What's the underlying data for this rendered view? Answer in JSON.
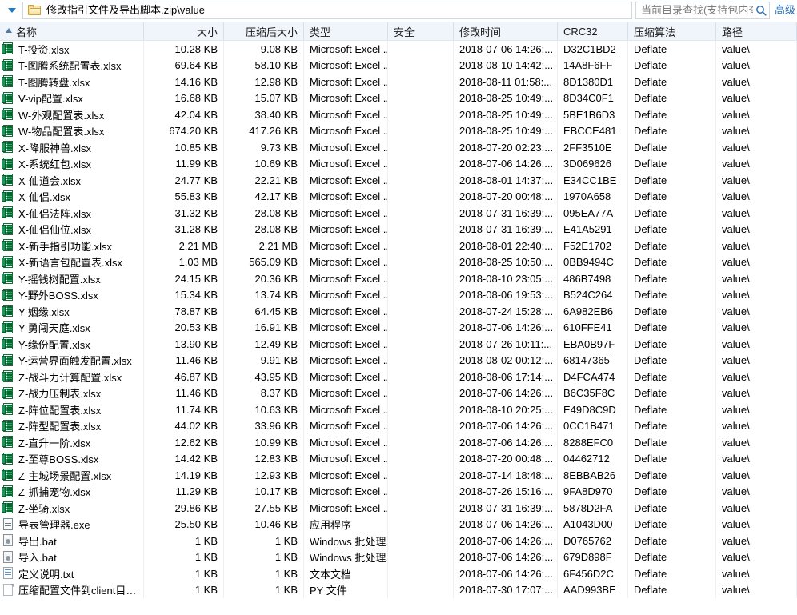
{
  "window": {
    "path": "修改指引文件及导出脚本.zip\\value",
    "nav_caret": "chevron-down-icon",
    "folder_icon": "folder-icon"
  },
  "search": {
    "placeholder": "当前目录查找(支持包内查找)",
    "icon": "search-icon",
    "advanced_label": "高级"
  },
  "columns": [
    {
      "key": "name",
      "label": "名称",
      "align": "left",
      "sorted": true
    },
    {
      "key": "size",
      "label": "大小",
      "align": "right",
      "sorted": false
    },
    {
      "key": "csize",
      "label": "压缩后大小",
      "align": "right",
      "sorted": false
    },
    {
      "key": "type",
      "label": "类型",
      "align": "left",
      "sorted": false
    },
    {
      "key": "sec",
      "label": "安全",
      "align": "left",
      "sorted": false
    },
    {
      "key": "time",
      "label": "修改时间",
      "align": "left",
      "sorted": false
    },
    {
      "key": "crc",
      "label": "CRC32",
      "align": "left",
      "sorted": false
    },
    {
      "key": "algo",
      "label": "压缩算法",
      "align": "left",
      "sorted": false
    },
    {
      "key": "path",
      "label": "路径",
      "align": "left",
      "sorted": false
    }
  ],
  "rows": [
    {
      "icon": "excel-file-icon",
      "kind": "xlsx",
      "name": "T-投资.xlsx",
      "size": "10.28 KB",
      "csize": "9.08 KB",
      "type": "Microsoft Excel ...",
      "sec": "",
      "time": "2018-07-06 14:26:...",
      "crc": "D32C1BD2",
      "algo": "Deflate",
      "path": "value\\"
    },
    {
      "icon": "excel-file-icon",
      "kind": "xlsx",
      "name": "T-图腾系统配置表.xlsx",
      "size": "69.64 KB",
      "csize": "58.10 KB",
      "type": "Microsoft Excel ...",
      "sec": "",
      "time": "2018-08-10 14:42:...",
      "crc": "14A8F6FF",
      "algo": "Deflate",
      "path": "value\\"
    },
    {
      "icon": "excel-file-icon",
      "kind": "xlsx",
      "name": "T-图腾转盘.xlsx",
      "size": "14.16 KB",
      "csize": "12.98 KB",
      "type": "Microsoft Excel ...",
      "sec": "",
      "time": "2018-08-11 01:58:...",
      "crc": "8D1380D1",
      "algo": "Deflate",
      "path": "value\\"
    },
    {
      "icon": "excel-file-icon",
      "kind": "xlsx",
      "name": "V-vip配置.xlsx",
      "size": "16.68 KB",
      "csize": "15.07 KB",
      "type": "Microsoft Excel ...",
      "sec": "",
      "time": "2018-08-25 10:49:...",
      "crc": "8D34C0F1",
      "algo": "Deflate",
      "path": "value\\"
    },
    {
      "icon": "excel-file-icon",
      "kind": "xlsx",
      "name": "W-外观配置表.xlsx",
      "size": "42.04 KB",
      "csize": "38.40 KB",
      "type": "Microsoft Excel ...",
      "sec": "",
      "time": "2018-08-25 10:49:...",
      "crc": "5BE1B6D3",
      "algo": "Deflate",
      "path": "value\\"
    },
    {
      "icon": "excel-file-icon",
      "kind": "xlsx",
      "name": "W-物品配置表.xlsx",
      "size": "674.20 KB",
      "csize": "417.26 KB",
      "type": "Microsoft Excel ...",
      "sec": "",
      "time": "2018-08-25 10:49:...",
      "crc": "EBCCE481",
      "algo": "Deflate",
      "path": "value\\"
    },
    {
      "icon": "excel-file-icon",
      "kind": "xlsx",
      "name": "X-降服神兽.xlsx",
      "size": "10.85 KB",
      "csize": "9.73 KB",
      "type": "Microsoft Excel ...",
      "sec": "",
      "time": "2018-07-20 02:23:...",
      "crc": "2FF3510E",
      "algo": "Deflate",
      "path": "value\\"
    },
    {
      "icon": "excel-file-icon",
      "kind": "xlsx",
      "name": "X-系统红包.xlsx",
      "size": "11.99 KB",
      "csize": "10.69 KB",
      "type": "Microsoft Excel ...",
      "sec": "",
      "time": "2018-07-06 14:26:...",
      "crc": "3D069626",
      "algo": "Deflate",
      "path": "value\\"
    },
    {
      "icon": "excel-file-icon",
      "kind": "xlsx",
      "name": "X-仙道会.xlsx",
      "size": "24.77 KB",
      "csize": "22.21 KB",
      "type": "Microsoft Excel ...",
      "sec": "",
      "time": "2018-08-01 14:37:...",
      "crc": "E34CC1BE",
      "algo": "Deflate",
      "path": "value\\"
    },
    {
      "icon": "excel-file-icon",
      "kind": "xlsx",
      "name": "X-仙侣.xlsx",
      "size": "55.83 KB",
      "csize": "42.17 KB",
      "type": "Microsoft Excel ...",
      "sec": "",
      "time": "2018-07-20 00:48:...",
      "crc": "1970A658",
      "algo": "Deflate",
      "path": "value\\"
    },
    {
      "icon": "excel-file-icon",
      "kind": "xlsx",
      "name": "X-仙侣法阵.xlsx",
      "size": "31.32 KB",
      "csize": "28.08 KB",
      "type": "Microsoft Excel ...",
      "sec": "",
      "time": "2018-07-31 16:39:...",
      "crc": "095EA77A",
      "algo": "Deflate",
      "path": "value\\"
    },
    {
      "icon": "excel-file-icon",
      "kind": "xlsx",
      "name": "X-仙侣仙位.xlsx",
      "size": "31.28 KB",
      "csize": "28.08 KB",
      "type": "Microsoft Excel ...",
      "sec": "",
      "time": "2018-07-31 16:39:...",
      "crc": "E41A5291",
      "algo": "Deflate",
      "path": "value\\"
    },
    {
      "icon": "excel-file-icon",
      "kind": "xlsx",
      "name": "X-新手指引功能.xlsx",
      "size": "2.21 MB",
      "csize": "2.21 MB",
      "type": "Microsoft Excel ...",
      "sec": "",
      "time": "2018-08-01 22:40:...",
      "crc": "F52E1702",
      "algo": "Deflate",
      "path": "value\\"
    },
    {
      "icon": "excel-file-icon",
      "kind": "xlsx",
      "name": "X-新语言包配置表.xlsx",
      "size": "1.03 MB",
      "csize": "565.09 KB",
      "type": "Microsoft Excel ...",
      "sec": "",
      "time": "2018-08-25 10:50:...",
      "crc": "0BB9494C",
      "algo": "Deflate",
      "path": "value\\"
    },
    {
      "icon": "excel-file-icon",
      "kind": "xlsx",
      "name": "Y-摇钱树配置.xlsx",
      "size": "24.15 KB",
      "csize": "20.36 KB",
      "type": "Microsoft Excel ...",
      "sec": "",
      "time": "2018-08-10 23:05:...",
      "crc": "486B7498",
      "algo": "Deflate",
      "path": "value\\"
    },
    {
      "icon": "excel-file-icon",
      "kind": "xlsx",
      "name": "Y-野外BOSS.xlsx",
      "size": "15.34 KB",
      "csize": "13.74 KB",
      "type": "Microsoft Excel ...",
      "sec": "",
      "time": "2018-08-06 19:53:...",
      "crc": "B524C264",
      "algo": "Deflate",
      "path": "value\\"
    },
    {
      "icon": "excel-file-icon",
      "kind": "xlsx",
      "name": "Y-姻缘.xlsx",
      "size": "78.87 KB",
      "csize": "64.45 KB",
      "type": "Microsoft Excel ...",
      "sec": "",
      "time": "2018-07-24 15:28:...",
      "crc": "6A982EB6",
      "algo": "Deflate",
      "path": "value\\"
    },
    {
      "icon": "excel-file-icon",
      "kind": "xlsx",
      "name": "Y-勇闯天庭.xlsx",
      "size": "20.53 KB",
      "csize": "16.91 KB",
      "type": "Microsoft Excel ...",
      "sec": "",
      "time": "2018-07-06 14:26:...",
      "crc": "610FFE41",
      "algo": "Deflate",
      "path": "value\\"
    },
    {
      "icon": "excel-file-icon",
      "kind": "xlsx",
      "name": "Y-缘份配置.xlsx",
      "size": "13.90 KB",
      "csize": "12.49 KB",
      "type": "Microsoft Excel ...",
      "sec": "",
      "time": "2018-07-26 10:11:...",
      "crc": "EBA0B97F",
      "algo": "Deflate",
      "path": "value\\"
    },
    {
      "icon": "excel-file-icon",
      "kind": "xlsx",
      "name": "Y-运营界面触发配置.xlsx",
      "size": "11.46 KB",
      "csize": "9.91 KB",
      "type": "Microsoft Excel ...",
      "sec": "",
      "time": "2018-08-02 00:12:...",
      "crc": "68147365",
      "algo": "Deflate",
      "path": "value\\"
    },
    {
      "icon": "excel-file-icon",
      "kind": "xlsx",
      "name": "Z-战斗力计算配置.xlsx",
      "size": "46.87 KB",
      "csize": "43.95 KB",
      "type": "Microsoft Excel ...",
      "sec": "",
      "time": "2018-08-06 17:14:...",
      "crc": "D4FCA474",
      "algo": "Deflate",
      "path": "value\\"
    },
    {
      "icon": "excel-file-icon",
      "kind": "xlsx",
      "name": "Z-战力压制表.xlsx",
      "size": "11.46 KB",
      "csize": "8.37 KB",
      "type": "Microsoft Excel ...",
      "sec": "",
      "time": "2018-07-06 14:26:...",
      "crc": "B6C35F8C",
      "algo": "Deflate",
      "path": "value\\"
    },
    {
      "icon": "excel-file-icon",
      "kind": "xlsx",
      "name": "Z-阵位配置表.xlsx",
      "size": "11.74 KB",
      "csize": "10.63 KB",
      "type": "Microsoft Excel ...",
      "sec": "",
      "time": "2018-08-10 20:25:...",
      "crc": "E49D8C9D",
      "algo": "Deflate",
      "path": "value\\"
    },
    {
      "icon": "excel-file-icon",
      "kind": "xlsx",
      "name": "Z-阵型配置表.xlsx",
      "size": "44.02 KB",
      "csize": "33.96 KB",
      "type": "Microsoft Excel ...",
      "sec": "",
      "time": "2018-07-06 14:26:...",
      "crc": "0CC1B471",
      "algo": "Deflate",
      "path": "value\\"
    },
    {
      "icon": "excel-file-icon",
      "kind": "xlsx",
      "name": "Z-直升一阶.xlsx",
      "size": "12.62 KB",
      "csize": "10.99 KB",
      "type": "Microsoft Excel ...",
      "sec": "",
      "time": "2018-07-06 14:26:...",
      "crc": "8288EFC0",
      "algo": "Deflate",
      "path": "value\\"
    },
    {
      "icon": "excel-file-icon",
      "kind": "xlsx",
      "name": "Z-至尊BOSS.xlsx",
      "size": "14.42 KB",
      "csize": "12.83 KB",
      "type": "Microsoft Excel ...",
      "sec": "",
      "time": "2018-07-20 00:48:...",
      "crc": "04462712",
      "algo": "Deflate",
      "path": "value\\"
    },
    {
      "icon": "excel-file-icon",
      "kind": "xlsx",
      "name": "Z-主城场景配置.xlsx",
      "size": "14.19 KB",
      "csize": "12.93 KB",
      "type": "Microsoft Excel ...",
      "sec": "",
      "time": "2018-07-14 18:48:...",
      "crc": "8EBBAB26",
      "algo": "Deflate",
      "path": "value\\"
    },
    {
      "icon": "excel-file-icon",
      "kind": "xlsx",
      "name": "Z-抓捕宠物.xlsx",
      "size": "11.29 KB",
      "csize": "10.17 KB",
      "type": "Microsoft Excel ...",
      "sec": "",
      "time": "2018-07-26 15:16:...",
      "crc": "9FA8D970",
      "algo": "Deflate",
      "path": "value\\"
    },
    {
      "icon": "excel-file-icon",
      "kind": "xlsx",
      "name": "Z-坐骑.xlsx",
      "size": "29.86 KB",
      "csize": "27.55 KB",
      "type": "Microsoft Excel ...",
      "sec": "",
      "time": "2018-07-31 16:39:...",
      "crc": "5878D2FA",
      "algo": "Deflate",
      "path": "value\\"
    },
    {
      "icon": "exe-file-icon",
      "kind": "exe",
      "name": "导表管理器.exe",
      "size": "25.50 KB",
      "csize": "10.46 KB",
      "type": "应用程序",
      "sec": "",
      "time": "2018-07-06 14:26:...",
      "crc": "A1043D00",
      "algo": "Deflate",
      "path": "value\\"
    },
    {
      "icon": "bat-file-icon",
      "kind": "bat",
      "name": "导出.bat",
      "size": "1 KB",
      "csize": "1 KB",
      "type": "Windows 批处理...",
      "sec": "",
      "time": "2018-07-06 14:26:...",
      "crc": "D0765762",
      "algo": "Deflate",
      "path": "value\\"
    },
    {
      "icon": "bat-file-icon",
      "kind": "bat",
      "name": "导入.bat",
      "size": "1 KB",
      "csize": "1 KB",
      "type": "Windows 批处理...",
      "sec": "",
      "time": "2018-07-06 14:26:...",
      "crc": "679D898F",
      "algo": "Deflate",
      "path": "value\\"
    },
    {
      "icon": "txt-file-icon",
      "kind": "txt",
      "name": "定义说明.txt",
      "size": "1 KB",
      "csize": "1 KB",
      "type": "文本文档",
      "sec": "",
      "time": "2018-07-06 14:26:...",
      "crc": "6F456D2C",
      "algo": "Deflate",
      "path": "value\\"
    },
    {
      "icon": "py-file-icon",
      "kind": "py",
      "name": "压缩配置文件到client目录.py",
      "size": "1 KB",
      "csize": "1 KB",
      "type": "PY 文件",
      "sec": "",
      "time": "2018-07-30 17:07:...",
      "crc": "AAD993BE",
      "algo": "Deflate",
      "path": "value\\"
    }
  ],
  "colors": {
    "header_bg": "#f0f5fb",
    "accent_link": "#2b6fb3",
    "excel_green": "#1f9257",
    "folder_yellow": "#f5cf72"
  }
}
